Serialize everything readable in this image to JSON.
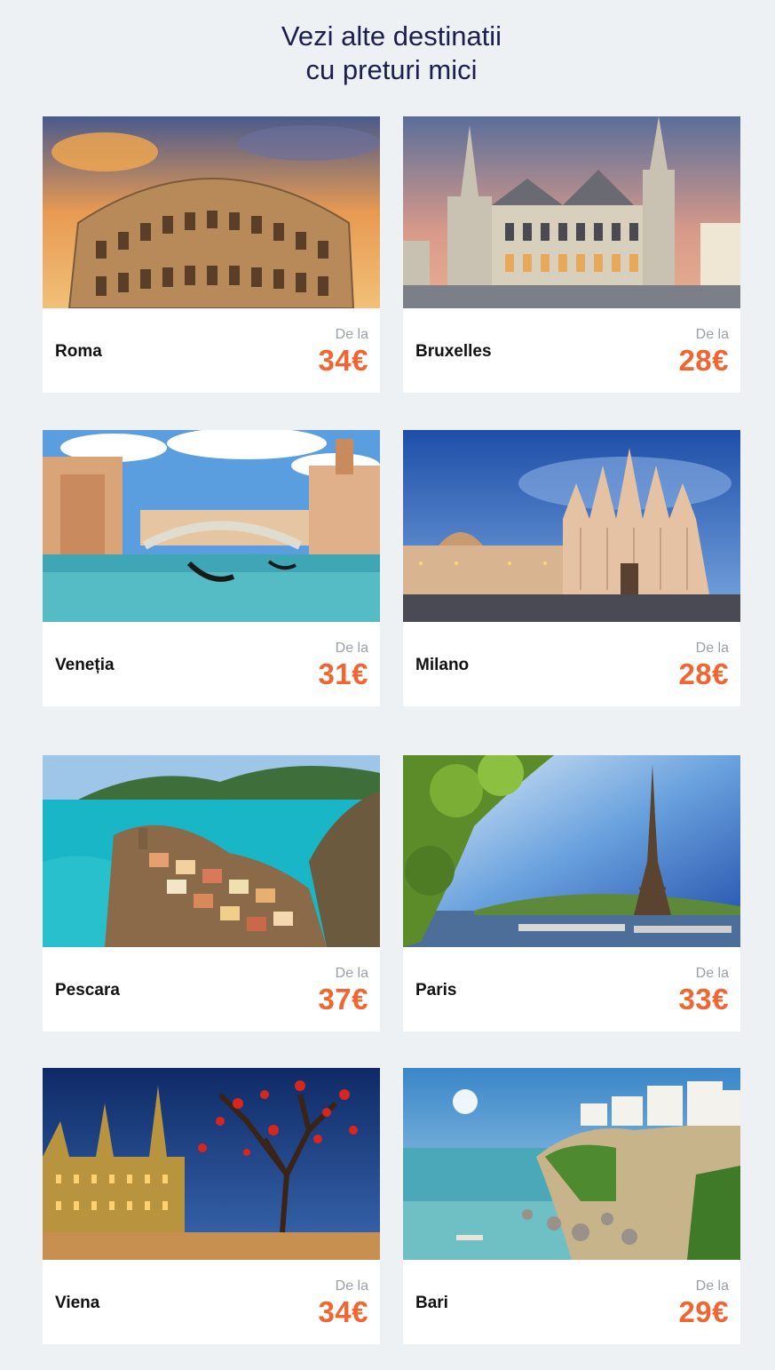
{
  "heading": {
    "line1": "Vezi alte destinatii",
    "line2": "cu preturi mici"
  },
  "accent_color": "#f26430",
  "destinations": [
    {
      "city": "Roma",
      "from_label": "De la",
      "price": "34€",
      "image": "colosseum-photo"
    },
    {
      "city": "Bruxelles",
      "from_label": "De la",
      "price": "28€",
      "image": "gothic-hall-photo"
    },
    {
      "city": "Veneția",
      "from_label": "De la",
      "price": "31€",
      "image": "grand-canal-photo"
    },
    {
      "city": "Milano",
      "from_label": "De la",
      "price": "28€",
      "image": "duomo-photo"
    },
    {
      "city": "Pescara",
      "from_label": "De la",
      "price": "37€",
      "image": "coastal-village-photo"
    },
    {
      "city": "Paris",
      "from_label": "De la",
      "price": "33€",
      "image": "eiffel-tower-photo"
    },
    {
      "city": "Viena",
      "from_label": "De la",
      "price": "34€",
      "image": "city-hall-night-photo"
    },
    {
      "city": "Bari",
      "from_label": "De la",
      "price": "29€",
      "image": "cliff-beach-photo"
    }
  ]
}
